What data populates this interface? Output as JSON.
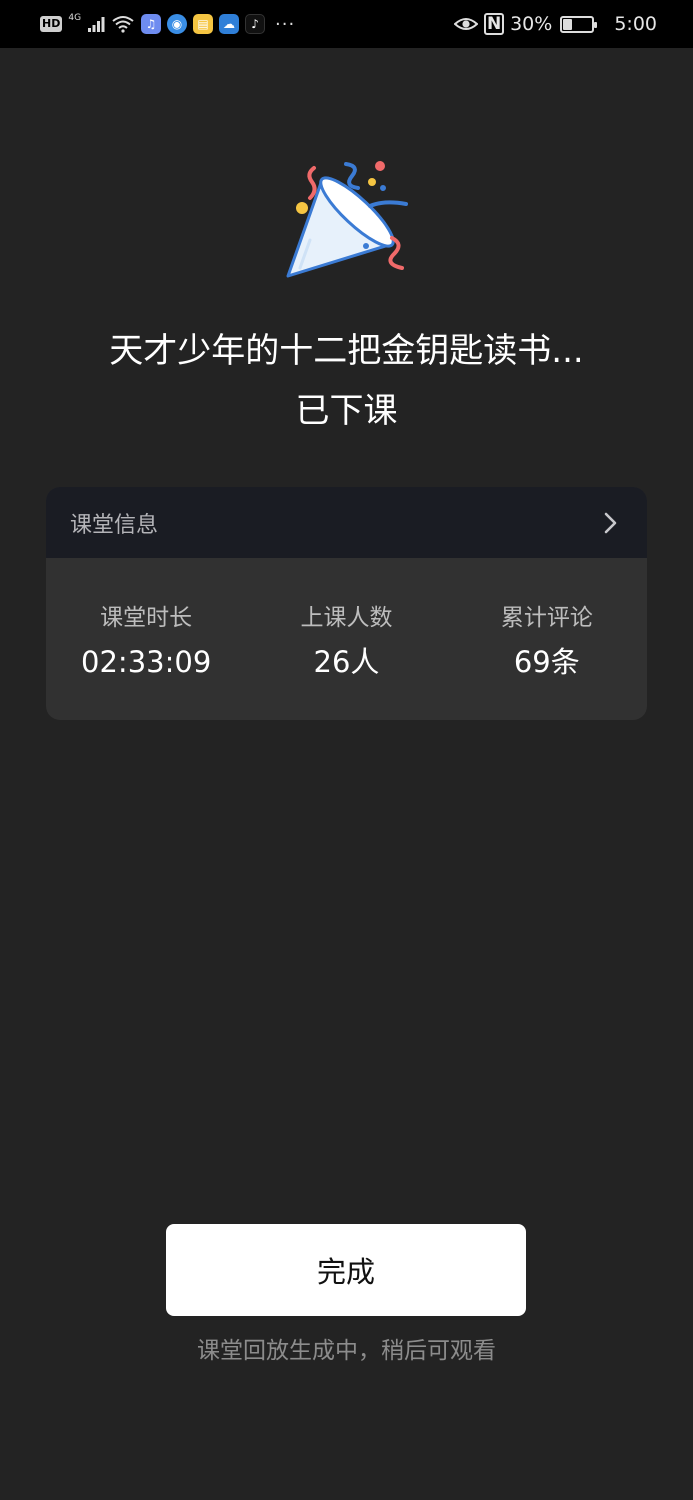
{
  "status_bar": {
    "hd": "HD",
    "network": "4G",
    "nfc": "N",
    "battery_percent": "30%",
    "battery_level": 0.3,
    "time": "5:00",
    "overflow": "···",
    "app_icons": [
      "music-app-icon",
      "browser-app-icon",
      "notes-app-icon",
      "cloud-app-icon",
      "tiktok-icon"
    ]
  },
  "celebration": {
    "icon": "party-popper-icon"
  },
  "header": {
    "title": "天才少年的十二把金钥匙读书...",
    "status": "已下课"
  },
  "class_info": {
    "label": "课堂信息",
    "stats": [
      {
        "label": "课堂时长",
        "value": "02:33:09"
      },
      {
        "label": "上课人数",
        "value": "26人"
      },
      {
        "label": "累计评论",
        "value": "69条"
      }
    ]
  },
  "actions": {
    "done_label": "完成",
    "replay_hint": "课堂回放生成中，稍后可观看"
  },
  "colors": {
    "background": "#232323",
    "card": "#313131",
    "card_header": "#1a1c23",
    "button": "#ffffff"
  }
}
